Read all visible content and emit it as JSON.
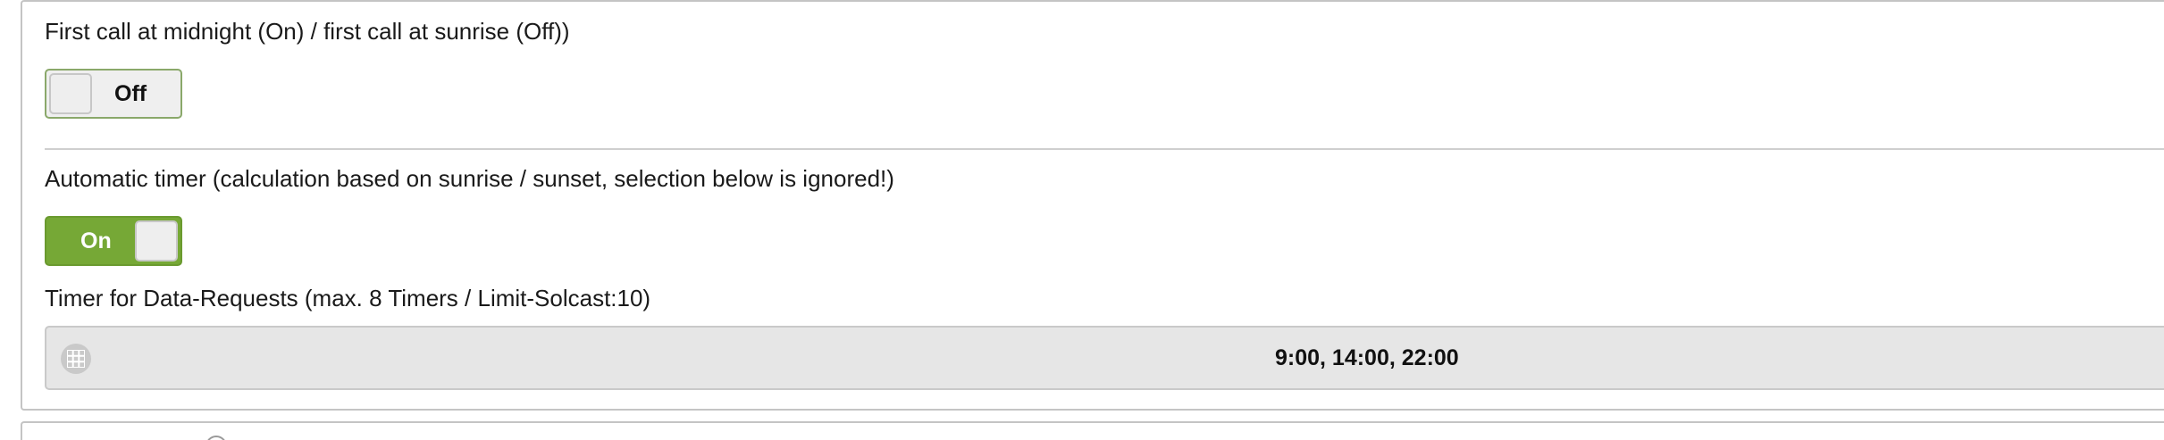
{
  "settings": {
    "first_call": {
      "label": "First call at midnight (On) / first call at sunrise (Off))",
      "toggle_state": "Off"
    },
    "automatic_timer": {
      "label": "Automatic timer (calculation based on sunrise / sunset, selection below is ignored!)",
      "toggle_state": "On"
    },
    "timer_requests": {
      "label": "Timer for Data-Requests (max. 8 Timers / Limit-Solcast:10)",
      "value": "9:00, 14:00, 22:00",
      "icon": "grid-icon"
    }
  },
  "colors": {
    "toggle_on": "#76a836",
    "toggle_off": "#efefef",
    "field_bg": "#e6e6e6"
  }
}
